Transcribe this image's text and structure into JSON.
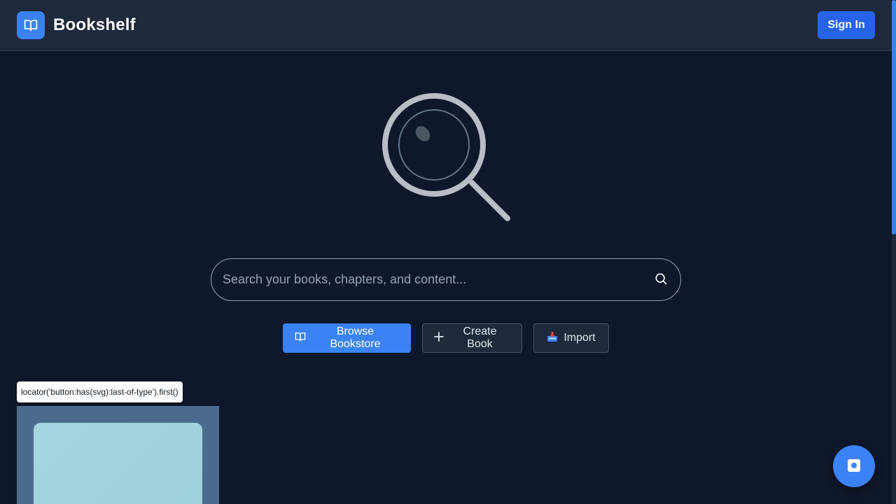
{
  "header": {
    "app_name": "Bookshelf",
    "logo_icon": "book-open-icon",
    "signin_label": "Sign In"
  },
  "hero": {
    "illustration_icon": "magnifier-icon"
  },
  "search": {
    "placeholder": "Search your books, chapters, and content...",
    "value": "",
    "icon": "search-icon"
  },
  "actions": [
    {
      "label": "Browse Bookstore",
      "icon": "book-open-icon"
    },
    {
      "label": "Create Book",
      "icon": "plus-icon"
    },
    {
      "label": "Import",
      "icon": "inbox-tray-icon"
    }
  ],
  "overlay": {
    "tooltip_text": "locator('button:has(svg):last-of-type').first()"
  },
  "fab": {
    "icon": "record-icon"
  },
  "colors": {
    "background": "#0f172a",
    "header": "#1e293b",
    "accent": "#3b82f6",
    "accent_dark": "#2563eb"
  }
}
